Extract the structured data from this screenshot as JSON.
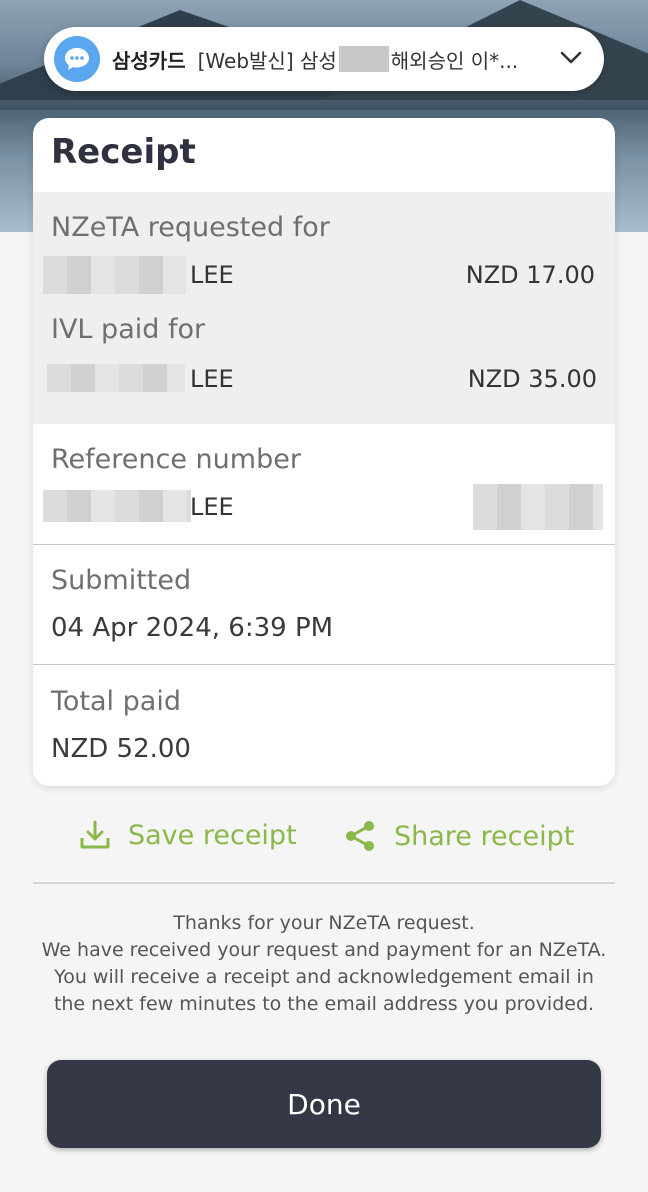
{
  "notification": {
    "app_name": "삼성카드",
    "message_prefix": "[Web발신] 삼성",
    "message_suffix": "해외승인 이*..."
  },
  "receipt": {
    "title": "Receipt",
    "nzeta_label": "NZeTA requested for",
    "nzeta_name": "LEE",
    "nzeta_amount": "NZD 17.00",
    "ivl_label": "IVL paid for",
    "ivl_name": "LEE",
    "ivl_amount": "NZD 35.00",
    "reference_label": "Reference number",
    "reference_name": "LEE",
    "submitted_label": "Submitted",
    "submitted_value": "04 Apr 2024, 6:39 PM",
    "total_label": "Total paid",
    "total_value": "NZD 52.00"
  },
  "actions": {
    "save_label": "Save receipt",
    "share_label": "Share receipt",
    "save_icon": "download-icon",
    "share_icon": "share-icon"
  },
  "message": {
    "line1": "Thanks for your NZeTA request.",
    "line2": "We have received your request and payment for an NZeTA.",
    "line3": "You will receive a receipt and acknowledgement email in",
    "line4": "the next few minutes to the email address you provided."
  },
  "done_label": "Done",
  "colors": {
    "accent_green": "#8bb84a",
    "button_dark": "#343846",
    "notification_icon_blue": "#5aa7f0"
  }
}
